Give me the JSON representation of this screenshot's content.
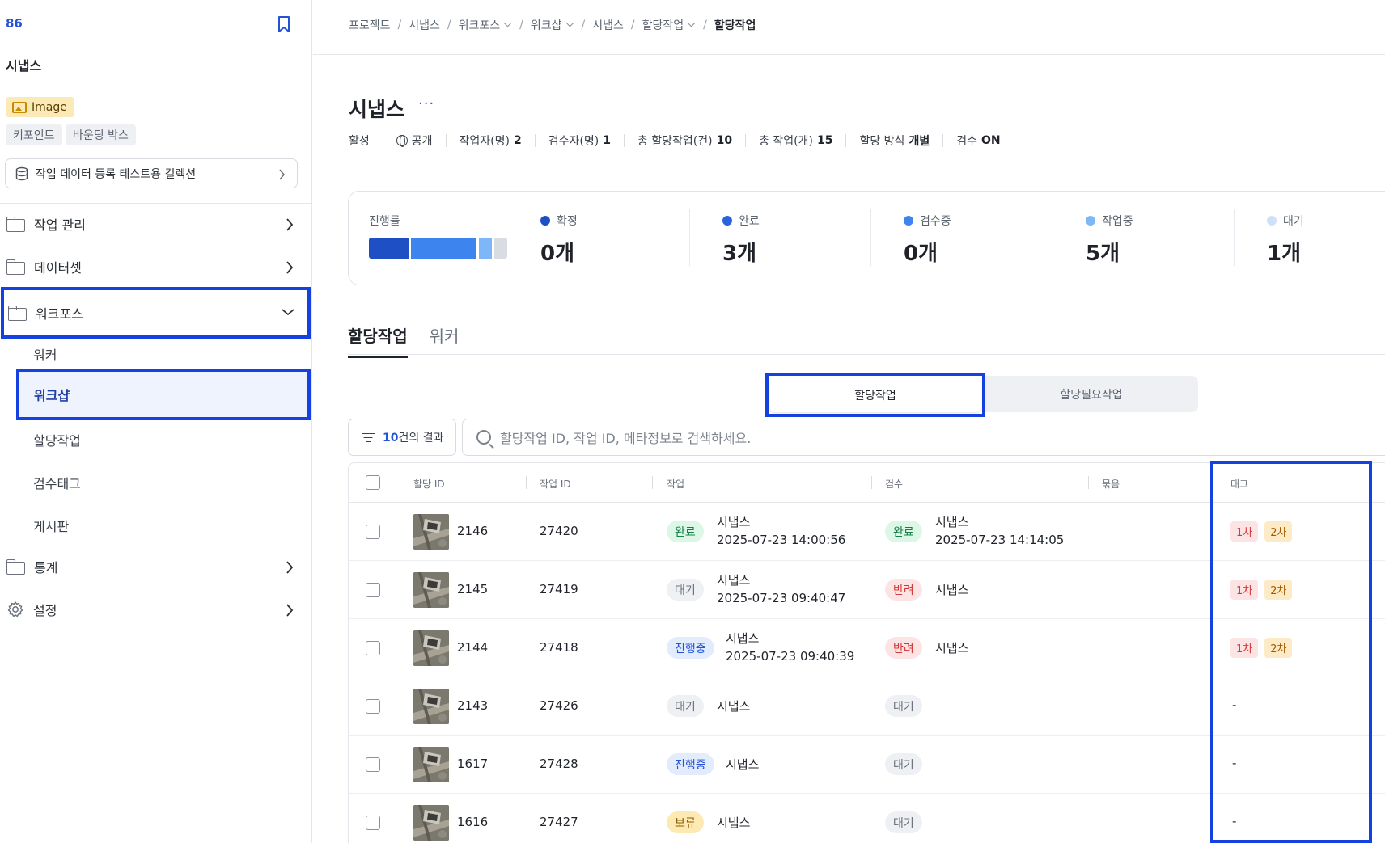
{
  "sidebar": {
    "project_id": "86",
    "title": "시냅스",
    "image_badge": "Image",
    "chips": [
      "키포인트",
      "바운딩 박스"
    ],
    "collection": "작업 데이터 등록 테스트용 컬렉션",
    "nav": [
      {
        "label": "작업 관리"
      },
      {
        "label": "데이터셋"
      },
      {
        "label": "워크포스"
      },
      {
        "label": "통계"
      },
      {
        "label": "설정"
      }
    ],
    "sub_items": [
      "워커",
      "워크샵",
      "할당작업",
      "검수태그",
      "게시판"
    ]
  },
  "breadcrumb": [
    "프로젝트",
    "시냅스",
    "워크포스",
    "워크샵",
    "시냅스",
    "할당작업",
    "할당작업"
  ],
  "header": {
    "title": "시냅스",
    "more": "···",
    "meta": {
      "status": "활성",
      "visibility": "공개",
      "workers_label": "작업자(명)",
      "workers_value": "2",
      "reviewers_label": "검수자(명)",
      "reviewers_value": "1",
      "total_assign_label": "총 할당작업(건)",
      "total_assign_value": "10",
      "total_tasks_label": "총 작업(개)",
      "total_tasks_value": "15",
      "method_label": "할당 방식",
      "method_value": "개별",
      "review_label": "검수",
      "review_value": "ON"
    }
  },
  "progress": {
    "label": "진행률",
    "bar_fractions": [
      0.3,
      0.5,
      0.1,
      0.1
    ],
    "bar_colors": [
      "#1f4fc4",
      "#3d84ee",
      "#7fb6f7",
      "#d9dde3"
    ],
    "stats": [
      {
        "label": "확정",
        "value": "0개",
        "color": "#1f4fc4"
      },
      {
        "label": "완료",
        "value": "3개",
        "color": "#2a62dc"
      },
      {
        "label": "검수중",
        "value": "0개",
        "color": "#3d84ee"
      },
      {
        "label": "작업중",
        "value": "5개",
        "color": "#7fb6f7"
      },
      {
        "label": "대기",
        "value": "1개",
        "color": "#cfe0fb"
      }
    ]
  },
  "tabs": [
    "할당작업",
    "워커"
  ],
  "segment": {
    "active": "할당작업",
    "other": "할당필요작업"
  },
  "filter": {
    "count": "10",
    "suffix": "건의 결과"
  },
  "search": {
    "placeholder": "할당작업 ID, 작업 ID, 메타정보로 검색하세요."
  },
  "table": {
    "columns": [
      "할당 ID",
      "작업 ID",
      "작업",
      "검수",
      "묶음",
      "태그"
    ],
    "rows": [
      {
        "assign_id": "2146",
        "task_id": "27420",
        "work_status": "완료",
        "work_user": "시냅스",
        "work_time": "2025-07-23 14:00:56",
        "review_status": "완료",
        "review_user": "시냅스",
        "review_time": "2025-07-23 14:14:05",
        "tags": [
          "1차",
          "2차"
        ]
      },
      {
        "assign_id": "2145",
        "task_id": "27419",
        "work_status": "대기",
        "work_user": "시냅스",
        "work_time": "2025-07-23 09:40:47",
        "review_status": "반려",
        "review_user": "시냅스",
        "review_time": "",
        "tags": [
          "1차",
          "2차"
        ]
      },
      {
        "assign_id": "2144",
        "task_id": "27418",
        "work_status": "진행중",
        "work_user": "시냅스",
        "work_time": "2025-07-23 09:40:39",
        "review_status": "반려",
        "review_user": "시냅스",
        "review_time": "",
        "tags": [
          "1차",
          "2차"
        ]
      },
      {
        "assign_id": "2143",
        "task_id": "27426",
        "work_status": "대기",
        "work_user": "시냅스",
        "work_time": "",
        "review_status": "대기",
        "review_user": "",
        "review_time": "",
        "tags": [],
        "tag_empty": "-"
      },
      {
        "assign_id": "1617",
        "task_id": "27428",
        "work_status": "진행중",
        "work_user": "시냅스",
        "work_time": "",
        "review_status": "대기",
        "review_user": "",
        "review_time": "",
        "tags": [],
        "tag_empty": "-"
      },
      {
        "assign_id": "1616",
        "task_id": "27427",
        "work_status": "보류",
        "work_user": "시냅스",
        "work_time": "",
        "review_status": "대기",
        "review_user": "",
        "review_time": "",
        "tags": [],
        "tag_empty": "-"
      }
    ]
  }
}
